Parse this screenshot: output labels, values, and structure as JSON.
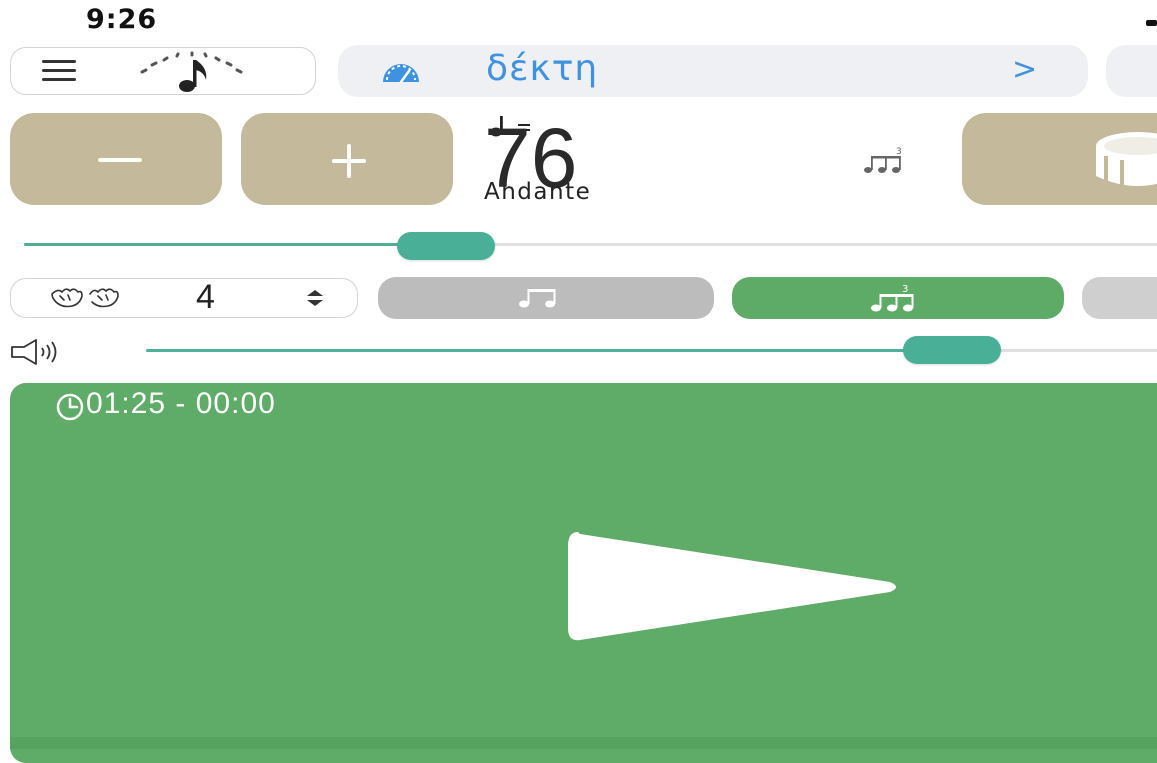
{
  "status_bar": {
    "time": "9:26"
  },
  "top_bar": {
    "preset_name": "δέκτη",
    "preset_chevron": ">"
  },
  "tempo": {
    "bpm": "76",
    "tempo_name": "Andante",
    "slider_value_fraction": 0.37
  },
  "beats": {
    "count": "4"
  },
  "subdivision": {
    "options": [
      "eighth",
      "triplet",
      "other"
    ],
    "selected": "triplet"
  },
  "volume": {
    "level_fraction": 0.79
  },
  "timer": {
    "text": "01:25 - 00:00"
  },
  "colors": {
    "accent_tan": "#c4b99a",
    "accent_green": "#5fab68",
    "slider_teal": "#4aaf97",
    "link_blue": "#3f92e0"
  },
  "icons": [
    "hamburger-menu-icon",
    "metronome-note-icon",
    "gauge-icon",
    "quarter-note-icon",
    "triplet-icon",
    "drum-icon",
    "hands-icon",
    "stepper-icon",
    "eighth-notes-icon",
    "speaker-icon",
    "clock-icon",
    "play-icon"
  ]
}
